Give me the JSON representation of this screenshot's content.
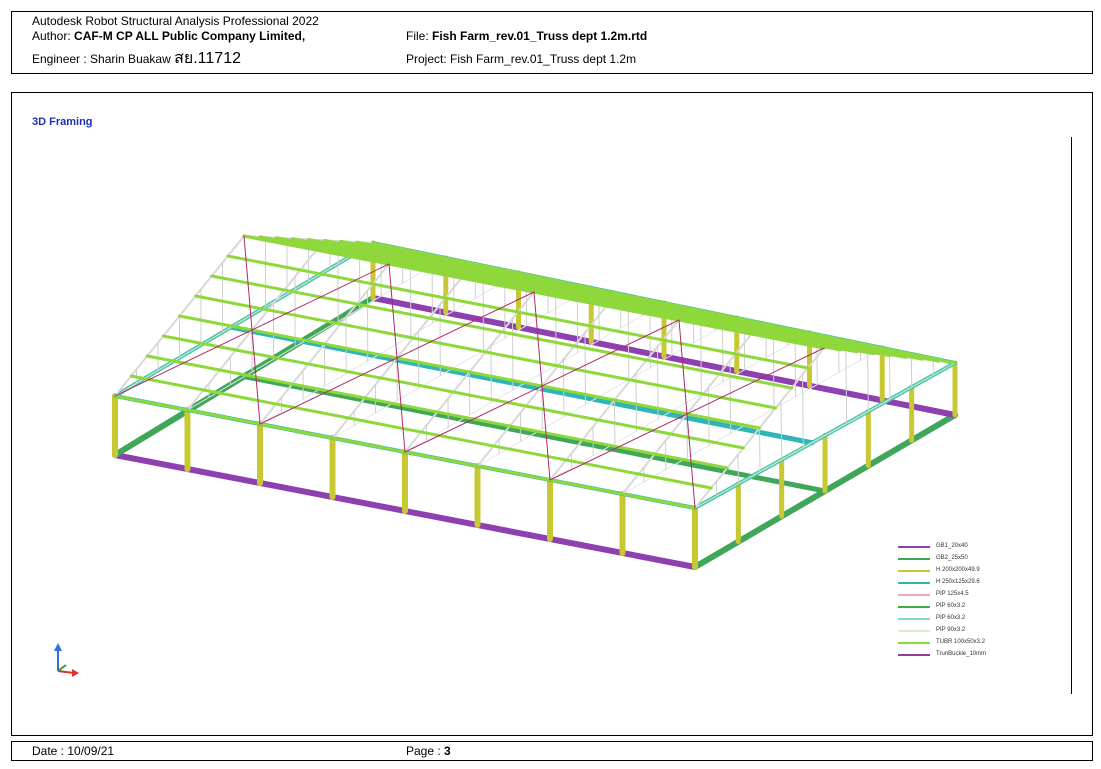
{
  "header": {
    "app_title": "Autodesk Robot Structural Analysis Professional 2022",
    "author_label": "Author:",
    "author_value": "CAF-M CP ALL Public Company Limited,",
    "engineer_label": "Engineer : Sharin Buakaw",
    "engineer_license": "สย.11712",
    "file_label": "File:",
    "file_value": "Fish Farm_rev.01_Truss dept 1.2m.rtd",
    "project_label": "Project:",
    "project_value": "Fish Farm_rev.01_Truss dept 1.2m"
  },
  "view": {
    "title": "3D Framing"
  },
  "legend": [
    {
      "label": "GB1_20x40",
      "color": "#8e3fb0"
    },
    {
      "label": "GB2_25x50",
      "color": "#3fa65a"
    },
    {
      "label": "H 200x200x49.9",
      "color": "#c8c832"
    },
    {
      "label": "H 250x125x29.6",
      "color": "#2fb5b5"
    },
    {
      "label": "PIP 125x4.5",
      "color": "#e6a8c0"
    },
    {
      "label": "PIP 60x3.2",
      "color": "#48a848"
    },
    {
      "label": "PIP 60x3.2",
      "color": "#7fd6d6"
    },
    {
      "label": "PIP 90x3.2",
      "color": "#d8ecd0"
    },
    {
      "label": "TUBR 100x50x3.2",
      "color": "#8ed83c"
    },
    {
      "label": "TrunBuckle_10mm",
      "color": "#8e3f9a"
    }
  ],
  "footer": {
    "date_label": "Date : 10/09/21",
    "page_label": "Page :",
    "page_value": "3"
  }
}
